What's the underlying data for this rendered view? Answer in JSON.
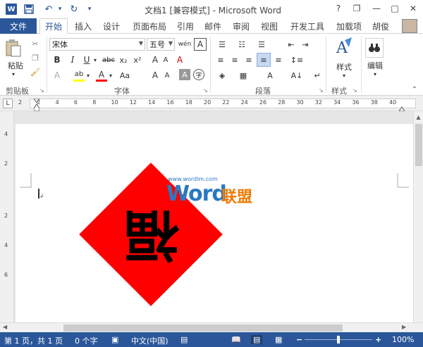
{
  "title": "文档1 [兼容模式] - Microsoft Word",
  "qat": {
    "save": "save-icon",
    "undo": "undo-icon",
    "redo": "redo-icon"
  },
  "window": {
    "help": "?",
    "minimize": "—",
    "restore": "❐",
    "close": "✕"
  },
  "tabs": [
    "文件",
    "开始",
    "插入",
    "设计",
    "页面布局",
    "引用",
    "邮件",
    "审阅",
    "视图",
    "开发工具",
    "加载项"
  ],
  "user": "胡俊",
  "ribbon": {
    "clipboard": {
      "paste": "粘贴",
      "label": "剪贴板"
    },
    "font": {
      "name": "宋体",
      "size": "五号",
      "label": "字体",
      "bold": "B",
      "italic": "I",
      "underline": "U",
      "strike": "abc",
      "sub": "x₂",
      "sup": "x²",
      "case": "Aa",
      "grow": "A",
      "shrink": "A",
      "clear": "A",
      "phonetic": "wén",
      "border": "A",
      "shade": "A",
      "circle": "字"
    },
    "paragraph": {
      "label": "段落"
    },
    "styles": {
      "button": "样式",
      "label": "样式"
    },
    "editing": {
      "button": "编辑"
    }
  },
  "ruler": {
    "h_ticks": [
      "2",
      "2",
      "4",
      "6",
      "8",
      "10",
      "12",
      "14",
      "16",
      "18",
      "20",
      "22",
      "24",
      "26",
      "28",
      "30",
      "32",
      "34",
      "36",
      "38",
      "40"
    ],
    "v_ticks": [
      "4",
      "2",
      "2",
      "4",
      "6"
    ]
  },
  "watermark": {
    "brand": "Word",
    "cn": "联盟",
    "url": "www.wordlm.com"
  },
  "fu_character": "福",
  "status": {
    "page": "第 1 页，共 1 页",
    "words": "0 个字",
    "lang": "中文(中国)",
    "zoom": "100%"
  },
  "colors": {
    "accent": "#2b579a",
    "fu_red": "#ff0000"
  }
}
